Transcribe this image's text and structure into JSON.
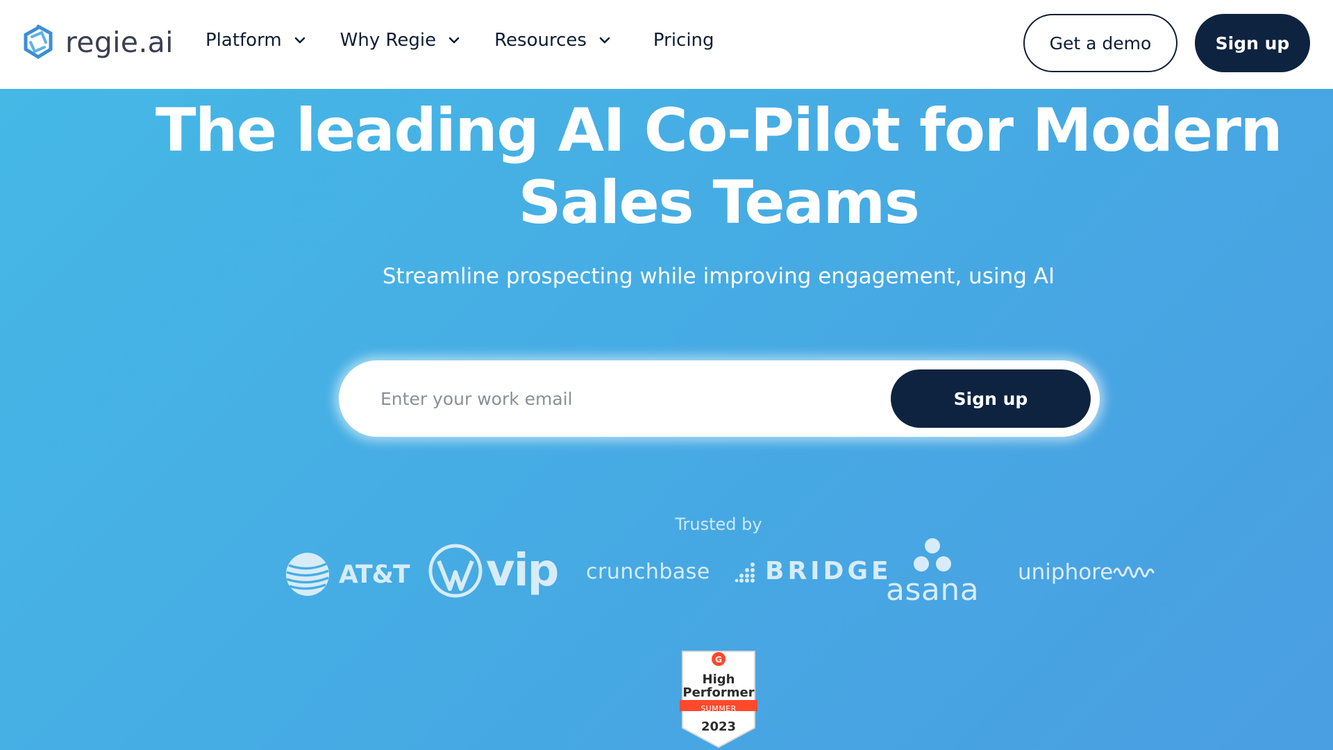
{
  "brand": {
    "name": "regie.ai",
    "color": "#3b8fd6"
  },
  "nav": {
    "items": [
      {
        "label": "Platform",
        "has_dropdown": true
      },
      {
        "label": "Why Regie",
        "has_dropdown": true
      },
      {
        "label": "Resources",
        "has_dropdown": true
      },
      {
        "label": "Pricing",
        "has_dropdown": false
      }
    ],
    "demo_button": "Get a demo",
    "signup_button": "Sign up"
  },
  "hero": {
    "headline_line1": "The leading AI Co-Pilot for Modern",
    "headline_line2": "Sales Teams",
    "subheadline": "Streamline prospecting while improving engagement, using AI",
    "email_placeholder": "Enter your work email",
    "email_value": "",
    "signup_button": "Sign up",
    "trusted_label": "Trusted by"
  },
  "logos": [
    {
      "name": "AT&T",
      "icon": "att-globe-icon"
    },
    {
      "name": "vip",
      "icon": "wordpress-icon"
    },
    {
      "name": "crunchbase",
      "icon": ""
    },
    {
      "name": "BRIDGE",
      "icon": "bridge-dots-icon"
    },
    {
      "name": "asana",
      "icon": "asana-dots-icon"
    },
    {
      "name": "uniphore",
      "icon": "uniphore-wave-icon"
    }
  ],
  "badge": {
    "provider": "G2",
    "line1": "High",
    "line2": "Performer",
    "season": "SUMMER",
    "year": "2023"
  },
  "colors": {
    "navy": "#0e2340",
    "hero_gradient_start": "#45b8e6",
    "hero_gradient_end": "#4a9ee2",
    "badge_red": "#ff492c"
  }
}
